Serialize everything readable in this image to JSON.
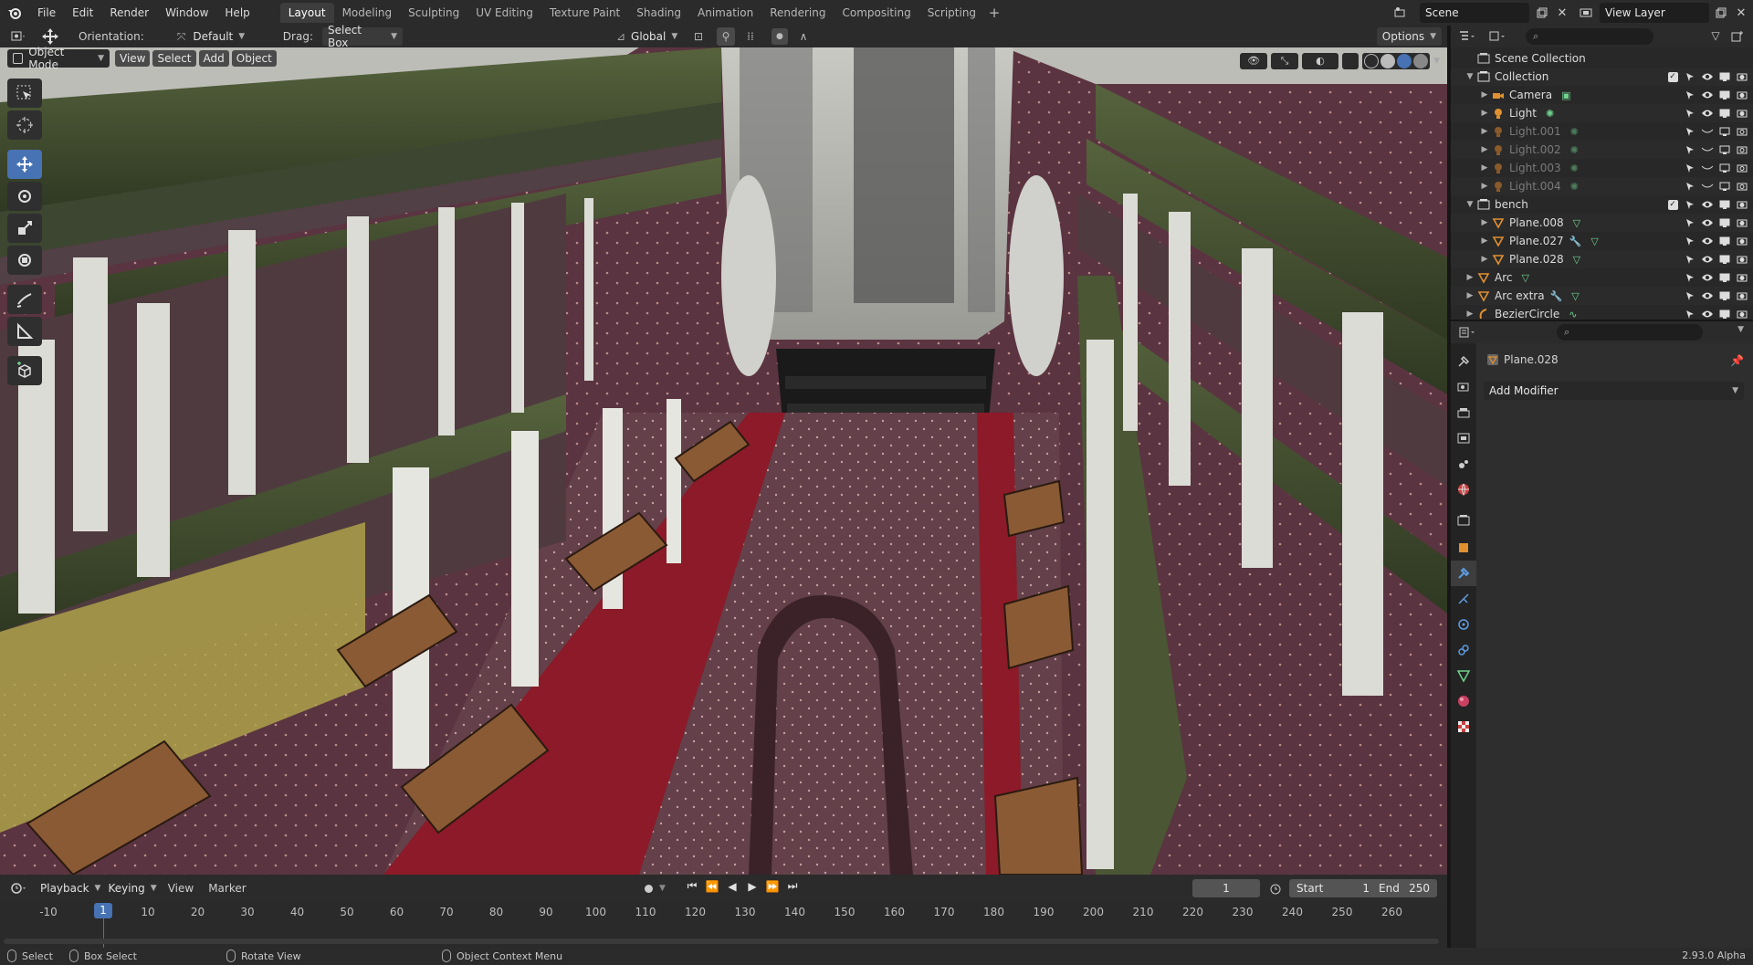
{
  "menu": [
    "File",
    "Edit",
    "Render",
    "Window",
    "Help"
  ],
  "workspaces": [
    "Layout",
    "Modeling",
    "Sculpting",
    "UV Editing",
    "Texture Paint",
    "Shading",
    "Animation",
    "Rendering",
    "Compositing",
    "Scripting"
  ],
  "active_workspace": "Layout",
  "scene": "Scene",
  "view_layer": "View Layer",
  "tool_header": {
    "orientation_label": "Orientation:",
    "orientation_value": "Default",
    "drag_label": "Drag:",
    "drag_value": "Select Box",
    "transform_orientation": "Global",
    "options": "Options"
  },
  "viewport_header": {
    "mode": "Object Mode",
    "view": "View",
    "select": "Select",
    "add": "Add",
    "object": "Object"
  },
  "outliner": {
    "root": "Scene Collection",
    "rows": [
      {
        "name": "Collection",
        "type": "collection"
      },
      {
        "name": "Camera",
        "type": "camera"
      },
      {
        "name": "Light",
        "type": "light"
      },
      {
        "name": "Light.001",
        "type": "light"
      },
      {
        "name": "Light.002",
        "type": "light"
      },
      {
        "name": "Light.003",
        "type": "light"
      },
      {
        "name": "Light.004",
        "type": "light"
      },
      {
        "name": "bench",
        "type": "collection"
      },
      {
        "name": "Plane.008",
        "type": "mesh"
      },
      {
        "name": "Plane.027",
        "type": "mesh"
      },
      {
        "name": "Plane.028",
        "type": "mesh"
      },
      {
        "name": "Arc",
        "type": "mesh"
      },
      {
        "name": "Arc extra",
        "type": "mesh"
      },
      {
        "name": "BezierCircle",
        "type": "curve"
      }
    ]
  },
  "properties": {
    "object_name": "Plane.028",
    "add_modifier": "Add Modifier"
  },
  "timeline": {
    "menu": [
      "Playback",
      "Keying",
      "View",
      "Marker"
    ],
    "current_frame": "1",
    "start_label": "Start",
    "start": "1",
    "end_label": "End",
    "end": "250",
    "ticks": [
      "-10",
      "1",
      "10",
      "20",
      "30",
      "40",
      "50",
      "60",
      "70",
      "80",
      "90",
      "100",
      "110",
      "120",
      "130",
      "140",
      "150",
      "160",
      "170",
      "180",
      "190",
      "200",
      "210",
      "220",
      "230",
      "240",
      "250",
      "260"
    ]
  },
  "status": {
    "select": "Select",
    "box_select": "Box Select",
    "rotate_view": "Rotate View",
    "context_menu": "Object Context Menu",
    "version": "2.93.0 Alpha"
  },
  "colors": {
    "accent": "#4772b3",
    "carpet": "#5a3440",
    "red_runner": "#8c1a28",
    "railing_green": "#3f4a2e",
    "pillar": "#d8d8d2",
    "wood": "#8a5a34"
  }
}
